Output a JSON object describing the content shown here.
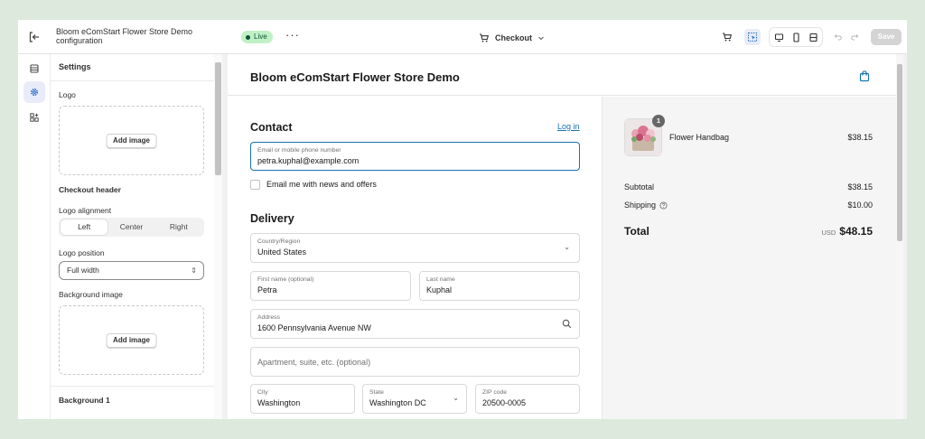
{
  "topbar": {
    "app_title": "Bloom eComStart Flower Store Demo configuration",
    "status_badge": "Live",
    "more_label": "···",
    "page_selector": "Checkout",
    "save_label": "Save"
  },
  "settings": {
    "title": "Settings",
    "logo_label": "Logo",
    "add_image": "Add image",
    "checkout_header": "Checkout header",
    "logo_alignment_label": "Logo alignment",
    "alignment_options": [
      "Left",
      "Center",
      "Right"
    ],
    "alignment_selected": "Left",
    "logo_position_label": "Logo position",
    "logo_position_value": "Full width",
    "background_image_label": "Background image",
    "background_1_label": "Background 1"
  },
  "preview": {
    "store_name": "Bloom eComStart Flower Store Demo",
    "contact": {
      "heading": "Contact",
      "login_link": "Log in",
      "email_label": "Email or mobile phone number",
      "email_value": "petra.kuphal@example.com",
      "newsletter_label": "Email me with news and offers"
    },
    "delivery": {
      "heading": "Delivery",
      "country_label": "Country/Region",
      "country_value": "United States",
      "first_name_label": "First name (optional)",
      "first_name_value": "Petra",
      "last_name_label": "Last name",
      "last_name_value": "Kuphal",
      "address_label": "Address",
      "address_value": "1600 Pennsylvania Avenue NW",
      "apartment_placeholder": "Apartment, suite, etc. (optional)",
      "city_label": "City",
      "city_value": "Washington",
      "state_label": "State",
      "state_value": "Washington DC",
      "zip_label": "ZIP code",
      "zip_value": "20500-0005"
    },
    "summary": {
      "product_name": "Flower Handbag",
      "product_qty": "1",
      "product_price": "$38.15",
      "subtotal_label": "Subtotal",
      "subtotal_value": "$38.15",
      "shipping_label": "Shipping",
      "shipping_value": "$10.00",
      "total_label": "Total",
      "total_currency": "USD",
      "total_value": "$48.15"
    }
  },
  "colors": {
    "accent": "#1773b0",
    "live_badge_bg": "#bff0c6",
    "page_bg": "#dce9dc"
  }
}
